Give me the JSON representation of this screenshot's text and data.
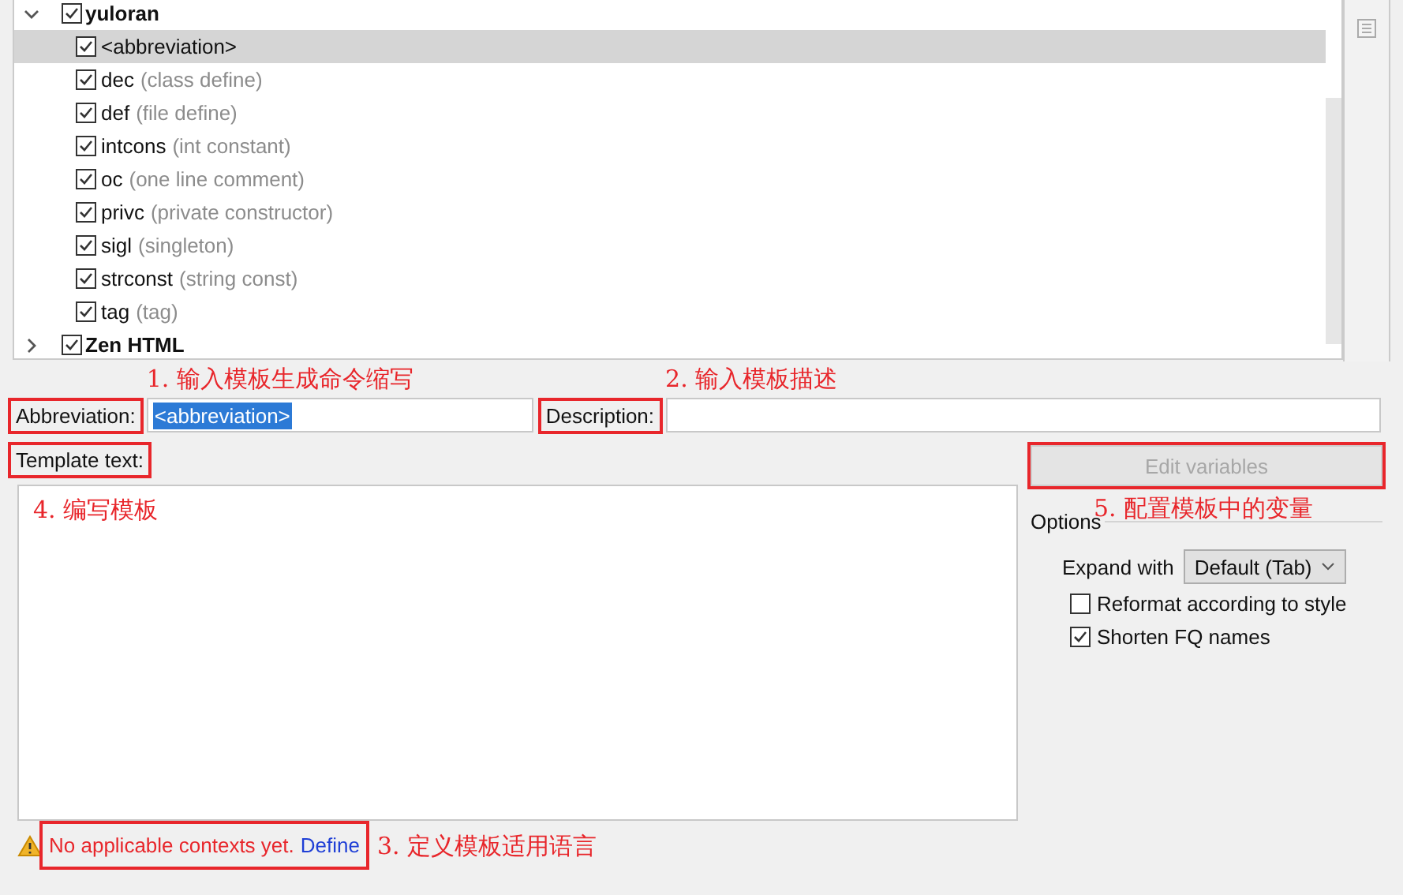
{
  "tree": {
    "groups": [
      {
        "name": "yuloran",
        "checked": true,
        "expanded": true,
        "children": [
          {
            "name": "<abbreviation>",
            "checked": true,
            "selected": true
          },
          {
            "name": "dec",
            "description": "(class define)",
            "checked": true,
            "selected": false
          },
          {
            "name": "def",
            "description": "(file define)",
            "checked": true,
            "selected": false
          },
          {
            "name": "intcons",
            "description": "(int constant)",
            "checked": true,
            "selected": false
          },
          {
            "name": "oc",
            "description": "(one line comment)",
            "checked": true,
            "selected": false
          },
          {
            "name": "privc",
            "description": "(private constructor)",
            "checked": true,
            "selected": false
          },
          {
            "name": "sigl",
            "description": "(singleton)",
            "checked": true,
            "selected": false
          },
          {
            "name": "strconst",
            "description": "(string const)",
            "checked": true,
            "selected": false
          },
          {
            "name": "tag",
            "description": "(tag)",
            "checked": true,
            "selected": false
          }
        ]
      },
      {
        "name": "Zen HTML",
        "checked": true,
        "expanded": false
      }
    ]
  },
  "abbreviation": {
    "label": "Abbreviation:",
    "value": "<abbreviation>",
    "value_selected": true,
    "boxed": true,
    "annotation": "1. 输入模板生成命令缩写"
  },
  "description": {
    "label": "Description:",
    "boxed": true,
    "annotation": "2. 输入模板描述"
  },
  "template_text": {
    "label": "Template text:",
    "boxed": true,
    "annotation": "4. 编写模板"
  },
  "edit_variables": {
    "label": "Edit variables",
    "disabled": true,
    "boxed": true,
    "annotation": "5. 配置模板中的变量"
  },
  "options": {
    "title": "Options",
    "expand_with": {
      "label": "Expand with",
      "value": "Default (Tab)"
    },
    "checkboxes": [
      {
        "label": "Reformat according to style",
        "checked": false
      },
      {
        "label": "Shorten FQ names",
        "checked": true
      }
    ]
  },
  "warning": {
    "text": "No applicable contexts yet.",
    "link": "Define",
    "boxed": true,
    "annotation": "3. 定义模板适用语言"
  }
}
